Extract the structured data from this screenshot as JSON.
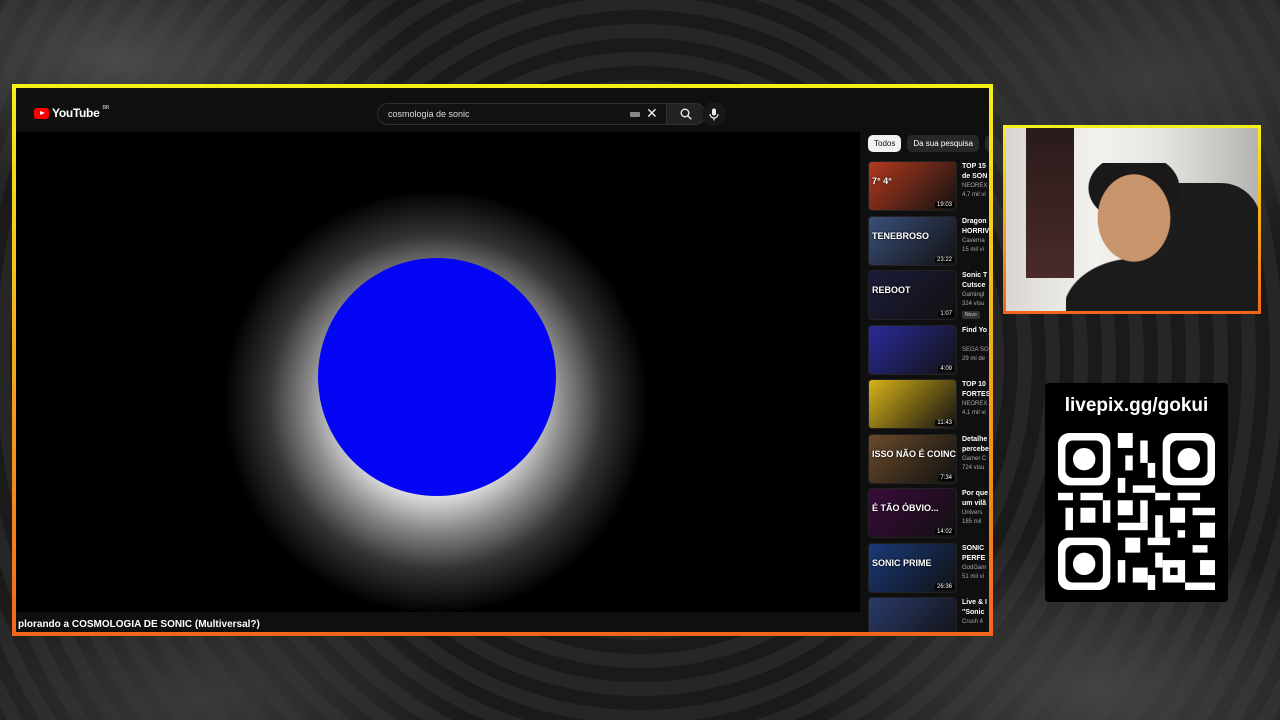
{
  "youtube": {
    "logo_text": "YouTube",
    "region": "BR",
    "search_value": "cosmologia de sonic",
    "video_title": "plorando a COSMOLOGIA DE SONIC (Multiversal?)",
    "chips": [
      "Todos",
      "Da sua pesquisa",
      "I"
    ],
    "related": [
      {
        "title1": "TOP 15",
        "title2": "de SON",
        "channel": "NEOREX",
        "views": "4,7 mil vi",
        "duration": "19:03",
        "thumb_color": "#b23a1e",
        "thumb_text": "7° 4°"
      },
      {
        "title1": "Dragon",
        "title2": "HORRIV",
        "channel": "Caverna",
        "views": "15 mil vi",
        "duration": "23:22",
        "thumb_color": "#3a4f7a",
        "thumb_text": "TENEBROSO"
      },
      {
        "title1": "Sonic T",
        "title2": "Cutsce",
        "channel": "Gamingl",
        "views": "324 visu",
        "duration": "1:07",
        "thumb_color": "#1b1b3a",
        "thumb_text": "REBOOT",
        "badge": "Novo"
      },
      {
        "title1": "Find Yo",
        "title2": "",
        "channel": "SEGA SO",
        "views": "29 mi de",
        "duration": "4:09",
        "thumb_color": "#2a2a9a",
        "thumb_text": ""
      },
      {
        "title1": "TOP 10",
        "title2": "FORTES",
        "channel": "NEOREX",
        "views": "4,1 mil vi",
        "duration": "11:43",
        "thumb_color": "#d8b21a",
        "thumb_text": ""
      },
      {
        "title1": "Detalhe",
        "title2": "percebe",
        "channel": "Gamer C",
        "views": "724 visu",
        "duration": "7:34",
        "thumb_color": "#6a4a2a",
        "thumb_text": "ISSO NÃO É COINCIDÊ"
      },
      {
        "title1": "Por que",
        "title2": "um vilã",
        "channel": "Univers",
        "views": "185 mil",
        "duration": "14:02",
        "thumb_color": "#3a0a3a",
        "thumb_text": "É TÃO ÓBVIO..."
      },
      {
        "title1": "SONIC",
        "title2": "PERFE",
        "channel": "GodGam",
        "views": "51 mil vi",
        "duration": "26:36",
        "thumb_color": "#1a3a7a",
        "thumb_text": "SONIC PRIME"
      },
      {
        "title1": "Live & I",
        "title2": "\"Sonic",
        "channel": "Crush 4",
        "views": "",
        "duration": "",
        "thumb_color": "#2a3a6a",
        "thumb_text": ""
      }
    ]
  },
  "overlay": {
    "donation_label": "livepix.gg/gokui"
  },
  "colors": {
    "frame_top": "#f5f01a",
    "frame_bottom": "#f2661c",
    "orb": "#0505f5"
  }
}
